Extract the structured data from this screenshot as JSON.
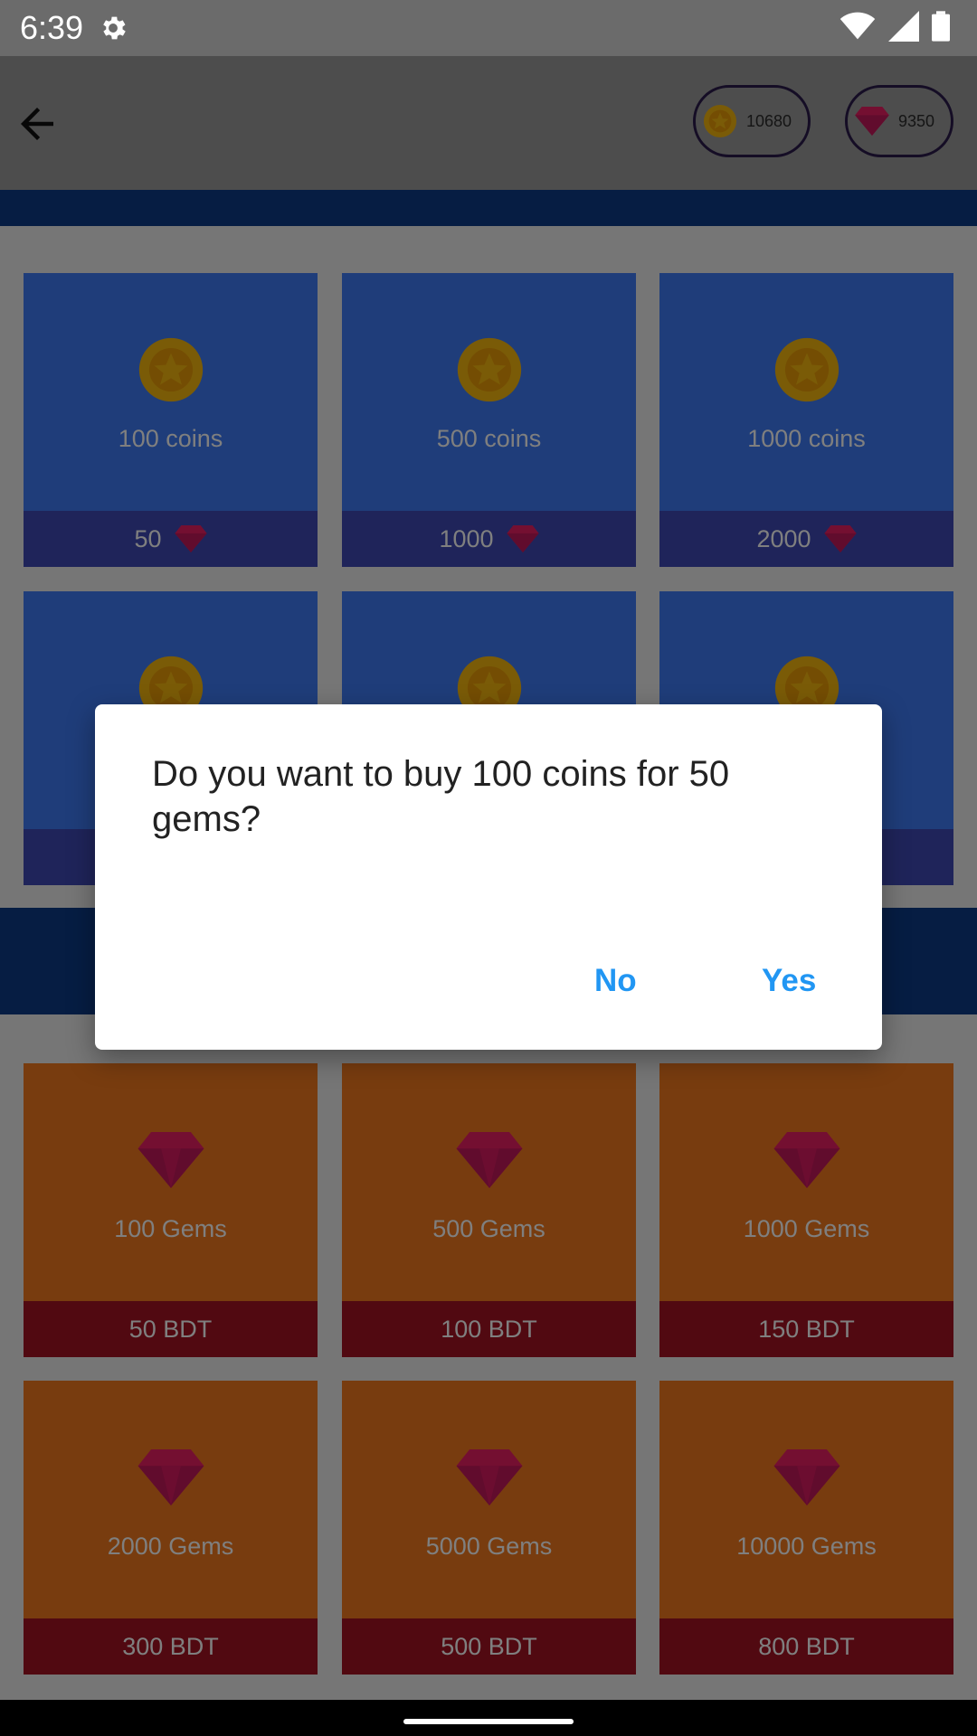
{
  "status_bar": {
    "time": "6:39"
  },
  "header": {
    "coins_balance": "10680",
    "gems_balance": "9350"
  },
  "coin_packs": [
    {
      "label": "100 coins",
      "price": "50"
    },
    {
      "label": "500 coins",
      "price": "1000"
    },
    {
      "label": "1000 coins",
      "price": "2000"
    }
  ],
  "gem_packs": [
    {
      "label": "100 Gems",
      "price": "50 BDT"
    },
    {
      "label": "500 Gems",
      "price": "100 BDT"
    },
    {
      "label": "1000 Gems",
      "price": "150 BDT"
    },
    {
      "label": "2000 Gems",
      "price": "300 BDT"
    },
    {
      "label": "5000 Gems",
      "price": "500 BDT"
    },
    {
      "label": "10000 Gems",
      "price": "800 BDT"
    }
  ],
  "dialog": {
    "message": "Do you want to buy 100 coins for 50 gems?",
    "no_label": "No",
    "yes_label": "Yes"
  },
  "colors": {
    "coin_card_top": "#3f7bf5",
    "coin_card_bottom": "#3e48b4",
    "gem_card_top": "#f0791e",
    "gem_card_bottom": "#a31322",
    "dialog_button": "#2196f3"
  },
  "icons": [
    "settings-gear-icon",
    "wifi-icon",
    "signal-icon",
    "battery-icon",
    "back-arrow-icon",
    "coin-icon",
    "gem-icon"
  ]
}
